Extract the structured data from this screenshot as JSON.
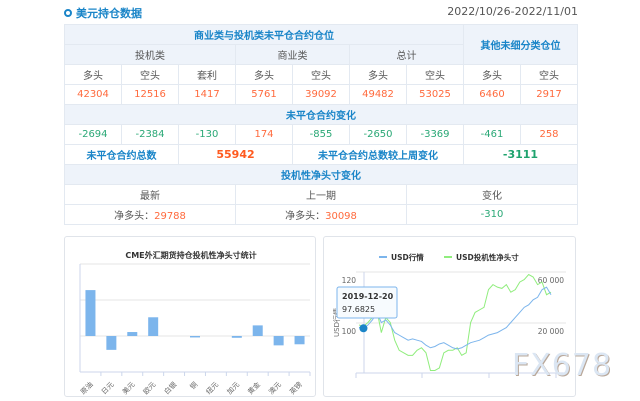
{
  "header": {
    "title": "美元持仓数据",
    "date_range": "2022/10/26-2022/11/01"
  },
  "table": {
    "group_title": "商业类与投机类未平仓合约仓位",
    "other_title": "其他未细分类仓位",
    "groups": [
      "投机类",
      "商业类",
      "总计"
    ],
    "sub": [
      "多头",
      "空头",
      "套利",
      "多头",
      "空头",
      "多头",
      "空头",
      "多头",
      "空头"
    ],
    "values": [
      "42304",
      "12516",
      "1417",
      "5761",
      "39092",
      "49482",
      "53025",
      "6460",
      "2917"
    ],
    "change_title": "未平仓合约变化",
    "changes": [
      "-2694",
      "-2384",
      "-130",
      "174",
      "-855",
      "-2650",
      "-3369",
      "-461",
      "258"
    ],
    "total_label": "未平仓合约总数",
    "total_value": "55942",
    "total_change_label": "未平仓合约总数较上周变化",
    "total_change_value": "-3111",
    "net_title": "投机性净头寸变化",
    "net_cols": [
      "最新",
      "上一期",
      "变化"
    ],
    "net_prefix": "净多头：",
    "net_latest": "29788",
    "net_prev": "30098",
    "net_change": "-310"
  },
  "colors": {
    "accent": "#1a85c8",
    "up": "#ff6a3d",
    "down": "#2aa876",
    "bar": "#7cb5ec",
    "line2": "#90ed7d"
  },
  "chart_data": [
    {
      "type": "bar",
      "title": "CME外汇期货持仓投机性净头寸统计",
      "categories": [
        "原油",
        "日元",
        "美元",
        "欧元",
        "白银",
        "铜",
        "纽元",
        "加元",
        "黄金",
        "澳元",
        "英镑"
      ],
      "values": [
        25500,
        -7700,
        2200,
        10400,
        0,
        -800,
        0,
        -1000,
        5900,
        -5200,
        -4600
      ],
      "ylim": [
        -20000,
        40000
      ],
      "grid": true
    },
    {
      "type": "line",
      "legend": [
        "USD行情",
        "USD投机性净头寸"
      ],
      "legend_position": "top",
      "ylabel": "USD行情",
      "left_ticks": [
        "120",
        "100"
      ],
      "right_ticks": [
        "60 000",
        "20 000"
      ],
      "left_ylim": [
        80,
        120
      ],
      "right_ylim": [
        -20000,
        60000
      ],
      "series": [
        {
          "name": "USD行情",
          "values": [
            98,
            97.7,
            99,
            101,
            104,
            100,
            101,
            99,
            96,
            95,
            94,
            93,
            93.5,
            93,
            92.5,
            91,
            90,
            90.5,
            91.5,
            92,
            91,
            90,
            89.5,
            90,
            91,
            92,
            92.5,
            93,
            94,
            95,
            95.5,
            96,
            97,
            98,
            100,
            102,
            104,
            106,
            107,
            109,
            110,
            113,
            114,
            111
          ]
        },
        {
          "name": "USD投机性净头寸",
          "values": [
            18000,
            17000,
            20000,
            24000,
            30000,
            12000,
            24000,
            20000,
            6000,
            -2000,
            -4000,
            -6000,
            -6000,
            -2000,
            0,
            -4000,
            -18000,
            -18000,
            -16000,
            -4000,
            -2000,
            -2000,
            0,
            -6000,
            -4000,
            20000,
            28000,
            30000,
            32000,
            46000,
            50000,
            48000,
            47000,
            50000,
            44000,
            46000,
            52000,
            54000,
            58000,
            56000,
            50000,
            52000,
            42000,
            44000
          ]
        }
      ],
      "tooltip": {
        "date": "2019-12-20",
        "value": "97.6825"
      }
    }
  ],
  "watermark": "FX678"
}
